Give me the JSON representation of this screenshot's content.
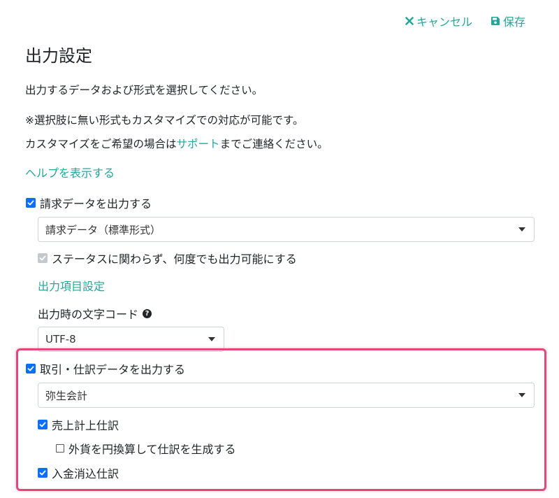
{
  "toolbar": {
    "cancel_label": "キャンセル",
    "save_label": "保存"
  },
  "page": {
    "title": "出力設定",
    "intro": "出力するデータおよび形式を選択してください。",
    "note1": "※選択肢に無い形式もカスタマイズでの対応が可能です。",
    "note2_before": "カスタマイズをご希望の場合は",
    "note2_link": "サポート",
    "note2_after": "までご連絡ください。",
    "help_link": "ヘルプを表示する"
  },
  "invoice": {
    "checkbox_label": "請求データを出力する",
    "checked": true,
    "format_value": "請求データ（標準形式）",
    "status_checkbox_label": "ステータスに関わらず、何度でも出力可能にする",
    "status_checked": true,
    "status_disabled": true,
    "items_link": "出力項目設定",
    "encoding_label": "出力時の文字コード",
    "encoding_value": "UTF-8"
  },
  "journal": {
    "checkbox_label": "取引・仕訳データを出力する",
    "checked": true,
    "format_value": "弥生会計",
    "sales_label": "売上計上仕訳",
    "sales_checked": true,
    "fx_label": "外貨を円換算して仕訳を生成する",
    "fx_checked": false,
    "receipt_label": "入金消込仕訳",
    "receipt_checked": true
  },
  "colors": {
    "accent": "#26a69a",
    "checkbox": "#0d6efd",
    "highlight": "#e5477b"
  },
  "icons": {
    "cancel": "close-icon",
    "save": "floppy-disk-icon",
    "help": "question-circle-icon",
    "dropdown": "caret-down-icon"
  }
}
